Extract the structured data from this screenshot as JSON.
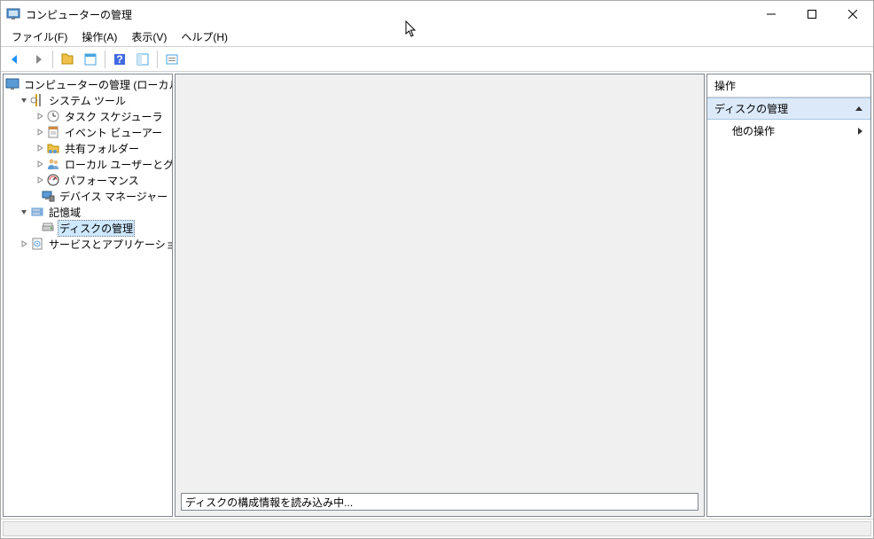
{
  "title": "コンピューターの管理",
  "menu": {
    "file": "ファイル(F)",
    "action": "操作(A)",
    "view": "表示(V)",
    "help": "ヘルプ(H)"
  },
  "tree": {
    "root": "コンピューターの管理 (ローカル)",
    "system_tools": "システム ツール",
    "task_scheduler": "タスク スケジューラ",
    "event_viewer": "イベント ビューアー",
    "shared_folders": "共有フォルダー",
    "local_users": "ローカル ユーザーとグループ",
    "performance": "パフォーマンス",
    "device_manager": "デバイス マネージャー",
    "storage": "記憶域",
    "disk_management": "ディスクの管理",
    "services_apps": "サービスとアプリケーション"
  },
  "actions": {
    "header": "操作",
    "section": "ディスクの管理",
    "other": "他の操作"
  },
  "status_text": "ディスクの構成情報を読み込み中..."
}
